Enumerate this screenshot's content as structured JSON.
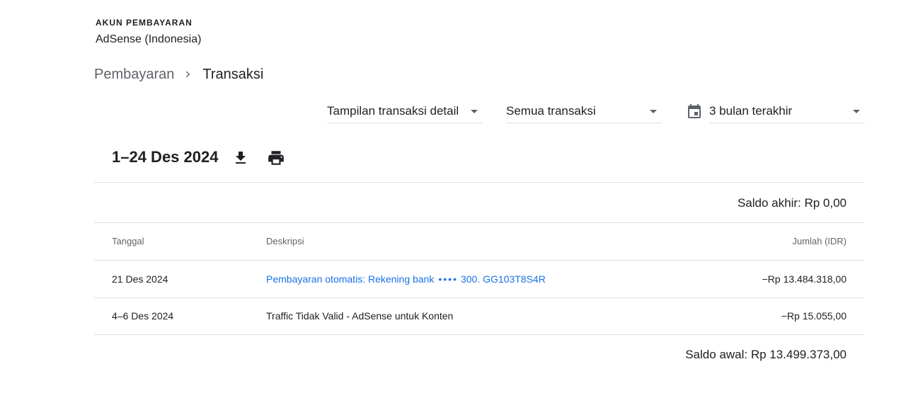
{
  "account": {
    "label": "AKUN PEMBAYARAN",
    "name": "AdSense (Indonesia)"
  },
  "breadcrumb": {
    "parent": "Pembayaran",
    "current": "Transaksi"
  },
  "filters": {
    "view": "Tampilan transaksi detail",
    "type": "Semua transaksi",
    "range": "3 bulan terakhir"
  },
  "period": {
    "title": "1–24 Des 2024"
  },
  "icons": {
    "chevron": "chevron-right-icon",
    "caret": "dropdown-caret-icon",
    "calendar": "calendar-icon",
    "download": "download-icon",
    "print": "print-icon"
  },
  "summary": {
    "closing_balance": "Saldo akhir: Rp 0,00",
    "opening_balance": "Saldo awal: Rp 13.499.373,00"
  },
  "table": {
    "headers": {
      "date": "Tanggal",
      "description": "Deskripsi",
      "amount": "Jumlah (IDR)"
    },
    "rows": [
      {
        "date": "21 Des 2024",
        "description": "Pembayaran otomatis: Rekening bank",
        "masked": "••••",
        "account_ref": "300. GG103T8S4R",
        "amount": "−Rp 13.484.318,00"
      },
      {
        "date": "4–6 Des 2024",
        "description": "Traffic Tidak Valid - AdSense untuk Konten",
        "amount": "−Rp 15.055,00"
      }
    ]
  },
  "colors": {
    "link": "#1a73e8",
    "text": "#202124",
    "secondary": "#5f6368",
    "divider": "#e0e0e0"
  }
}
